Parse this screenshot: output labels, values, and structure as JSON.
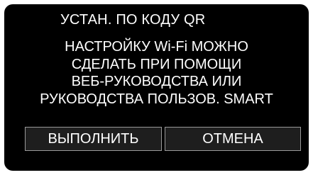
{
  "dialog": {
    "title": "УСТАН. ПО КОДУ QR",
    "message_lines": [
      "НАСТРОЙКУ Wi-Fi МОЖНО",
      "СДЕЛАТЬ ПРИ ПОМОЩИ",
      "ВЕБ-РУКОВОДСТВА  ИЛИ",
      "РУКОВОДСТВА ПОЛЬЗОВ. SMART"
    ],
    "buttons": {
      "execute_label": "ВЫПОЛНИТЬ",
      "cancel_label": "ОТМЕНА"
    }
  },
  "colors": {
    "background": "#000000",
    "text": "#ffffff",
    "button_fill": "#1e1e1e",
    "button_border": "#9a9a9a"
  }
}
